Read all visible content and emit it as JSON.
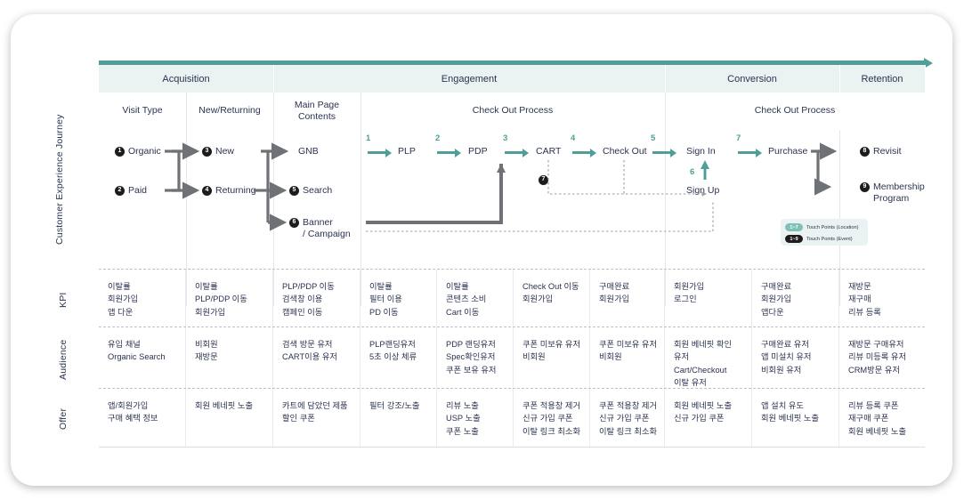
{
  "side_labels": {
    "journey": "Customer Experience Journey",
    "kpi": "KPI",
    "audience": "Audience",
    "offer": "Offer"
  },
  "phases": [
    {
      "label": "Acquisition"
    },
    {
      "label": "Engagement"
    },
    {
      "label": "Conversion"
    },
    {
      "label": "Retention"
    }
  ],
  "subheaders": [
    {
      "label": "Visit Type"
    },
    {
      "label": "New/Returning"
    },
    {
      "label": "Main Page\nContents"
    },
    {
      "label": "Check Out Process"
    },
    {
      "label": "Check Out Process"
    }
  ],
  "journey_nodes": [
    {
      "num": "1",
      "label": "Organic"
    },
    {
      "num": "2",
      "label": "Paid"
    },
    {
      "num": "3",
      "label": "New"
    },
    {
      "num": "4",
      "label": "Returning"
    },
    {
      "num": "5",
      "label": "Search"
    },
    {
      "num": "6",
      "label": "Banner"
    },
    {
      "num": "6b",
      "label": "/ Campaign"
    },
    {
      "num": "8",
      "label": "Revisit"
    },
    {
      "num": "9",
      "label": "Membership"
    },
    {
      "num": "9b",
      "label": "Program"
    }
  ],
  "node_gnb": "GNB",
  "node_plp": "PLP",
  "node_pdp": "PDP",
  "node_cart": "CART",
  "node_checkout": "Check Out",
  "node_signin": "Sign In",
  "node_signup": "Sign Up",
  "node_purchase": "Purchase",
  "node_revisit": "Revisit",
  "node_membership_1": "Membership",
  "node_membership_2": "Program",
  "node_banner_1": "Banner",
  "node_banner_2": "/ Campaign",
  "bullets": {
    "n1": "1",
    "n2": "2",
    "n3": "3",
    "n4": "4",
    "n5": "5",
    "n6": "6",
    "n7": "7",
    "n8": "8",
    "n9": "9"
  },
  "arrow_numbers": {
    "a1": "1",
    "a2": "2",
    "a3": "3",
    "a4": "4",
    "a5": "5",
    "a6": "6",
    "a7": "7"
  },
  "legend": {
    "location_pill": "1~7",
    "location_text": "Touch Points (Location)",
    "event_pill": "1~9",
    "event_text": "Touch Points (Event)"
  },
  "rows": {
    "kpi": [
      [
        "이탈률",
        "회원가입",
        "앱 다운"
      ],
      [
        "이탈률",
        "PLP/PDP 이동",
        "회원가입"
      ],
      [
        "PLP/PDP 이동",
        "검색창 이용",
        "캠페인 이동"
      ],
      [
        "이탈률",
        "필터 이용",
        "PD 이동"
      ],
      [
        "이탈률",
        "콘텐츠 소비",
        "Cart 이동"
      ],
      [
        "Check Out 이동",
        "회원가입"
      ],
      [
        "구매완료",
        "회원가입"
      ],
      [
        "회원가입",
        "로그인"
      ],
      [
        "구매완료",
        "회원가입",
        "앱다운"
      ],
      [
        "재방문",
        "재구매",
        "리뷰 등록"
      ]
    ],
    "audience": [
      [
        "유입 채널",
        "Organic Search"
      ],
      [
        "비회원",
        "재방문"
      ],
      [
        "검색 방문 유저",
        "CART이용 유저"
      ],
      [
        "PLP랜딩유저",
        "5초 이상 체류"
      ],
      [
        "PDP 랜딩유저",
        "Spec확인유저",
        "쿠폰 보유 유저"
      ],
      [
        "쿠폰 미보유 유저",
        "비회원"
      ],
      [
        "쿠폰 미보유 유저",
        "비회원"
      ],
      [
        "회원 베네핏 확인",
        "유저",
        "Cart/Checkout",
        "이탈 유저"
      ],
      [
        "구매완료 유저",
        "앱 미설치 유저",
        "비회원 유저"
      ],
      [
        "재방문 구매유저",
        "리뷰 미등록 유저",
        "CRM방문 유저"
      ]
    ],
    "offer": [
      [
        "앱/회원가입",
        "구매 혜택 정보"
      ],
      [
        "회원 베네핏 노출"
      ],
      [
        "카트에 담았던 제품",
        "할인 쿠폰"
      ],
      [
        "필터 강조/노출"
      ],
      [
        "리뷰 노출",
        "USP 노출",
        "쿠폰 노출"
      ],
      [
        "쿠폰 적용창 제거",
        "신규 가입 쿠폰",
        "이탈 링크 최소화"
      ],
      [
        "쿠폰 적용창 제거",
        "신규 가입 쿠폰",
        "이탈 링크 최소화"
      ],
      [
        "회원 베네핏 노출",
        "신규 가입 쿠폰"
      ],
      [
        "앱 설치 유도",
        "회원 베네핏 노출"
      ],
      [
        "리뷰 등록 쿠폰",
        "재구매 쿠폰",
        "회원 베네핏 노출"
      ]
    ]
  },
  "colors": {
    "teal": "#4f9f98",
    "teal_light": "#eaf3f1",
    "pill_light": "#7fc0b8",
    "text": "#2b3350",
    "grey_arrow": "#6e7276"
  }
}
